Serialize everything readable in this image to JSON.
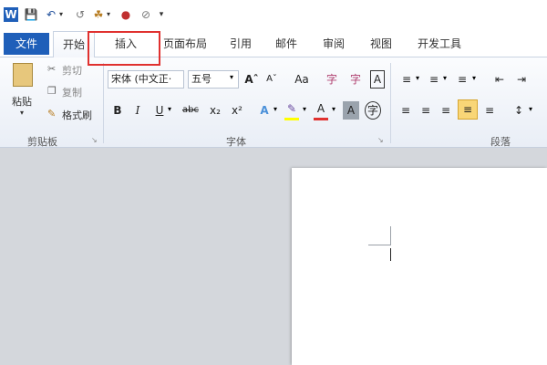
{
  "qat": {
    "app_icon": "W",
    "icons": [
      "save-icon",
      "undo-icon",
      "redo-icon",
      "format-painter-icon",
      "color-icon",
      "eraser-icon",
      "customize-icon"
    ]
  },
  "tabs": {
    "file": "文件",
    "items": [
      "开始",
      "插入",
      "页面布局",
      "引用",
      "邮件",
      "审阅",
      "视图",
      "开发工具"
    ]
  },
  "clipboard": {
    "paste": "粘贴",
    "cut": "剪切",
    "copy": "复制",
    "format_painter": "格式刷",
    "group_label": "剪贴板"
  },
  "font": {
    "font_name": "宋体 (中文正‧",
    "font_size": "五号",
    "grow": "Aˆ",
    "shrink": "Aˇ",
    "case": "Aa",
    "bold": "B",
    "italic": "I",
    "underline": "U",
    "strike": "abc",
    "subscript": "x₂",
    "superscript": "x²",
    "group_label": "字体",
    "phonetic": "字",
    "border_char": "A",
    "circle_char": "字"
  },
  "paragraph": {
    "group_label": "段落",
    "highlight_color": "#f9d677"
  },
  "colors": {
    "file_tab": "#1f5fb9",
    "highlight_box": "#e0312f",
    "font_color_bar": "#e0312f",
    "highlight_bar": "#ffff00"
  }
}
